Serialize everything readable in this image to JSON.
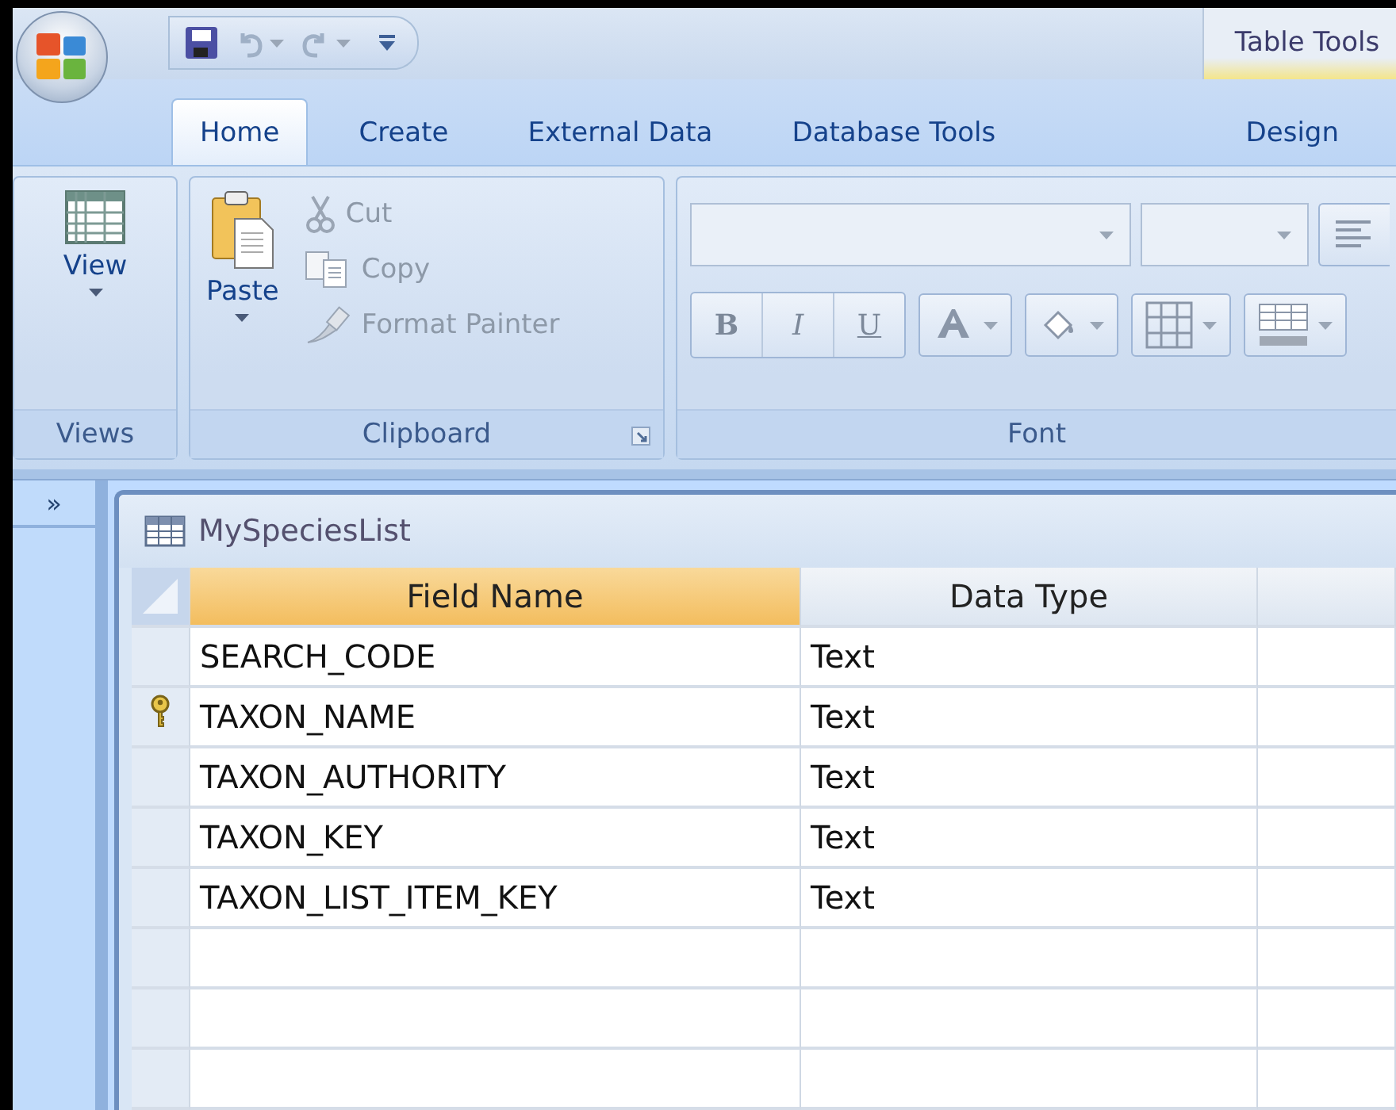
{
  "quick_access": [
    {
      "kind": "save",
      "disabled": false
    },
    {
      "kind": "undo",
      "disabled": true
    },
    {
      "kind": "redo",
      "disabled": true
    },
    {
      "kind": "customize",
      "disabled": false
    }
  ],
  "contextual_group": "Table Tools",
  "tabs": [
    {
      "label": "Home",
      "selected": true
    },
    {
      "label": "Create",
      "selected": false
    },
    {
      "label": "External Data",
      "selected": false
    },
    {
      "label": "Database Tools",
      "selected": false
    },
    {
      "label": "Design",
      "selected": false
    }
  ],
  "ribbon": {
    "views": {
      "label": "Views",
      "view_button": "View"
    },
    "clipboard": {
      "label": "Clipboard",
      "paste": {
        "label": "Paste",
        "disabled": false
      },
      "items": [
        {
          "kind": "cut",
          "label": "Cut",
          "disabled": true
        },
        {
          "kind": "copy",
          "label": "Copy",
          "disabled": true
        },
        {
          "kind": "format_painter",
          "label": "Format Painter",
          "disabled": true
        }
      ]
    },
    "font": {
      "label": "Font",
      "disabled": true,
      "format_buttons": [
        "B",
        "I",
        "U"
      ]
    }
  },
  "nav_pane": {
    "toggle": "»"
  },
  "document": {
    "title": "MySpeciesList",
    "columns": [
      {
        "label": "Field Name",
        "selected": true
      },
      {
        "label": "Data Type",
        "selected": false
      }
    ],
    "rows": [
      {
        "kind": "field",
        "field_name": "SEARCH_CODE",
        "data_type": "Text",
        "primary_key": false
      },
      {
        "kind": "field",
        "field_name": "TAXON_NAME",
        "data_type": "Text",
        "primary_key": true
      },
      {
        "kind": "field",
        "field_name": "TAXON_AUTHORITY",
        "data_type": "Text",
        "primary_key": false
      },
      {
        "kind": "field",
        "field_name": "TAXON_KEY",
        "data_type": "Text",
        "primary_key": false
      },
      {
        "kind": "field",
        "field_name": "TAXON_LIST_ITEM_KEY",
        "data_type": "Text",
        "primary_key": false
      },
      {
        "kind": "blank"
      },
      {
        "kind": "blank"
      },
      {
        "kind": "blank"
      }
    ]
  }
}
